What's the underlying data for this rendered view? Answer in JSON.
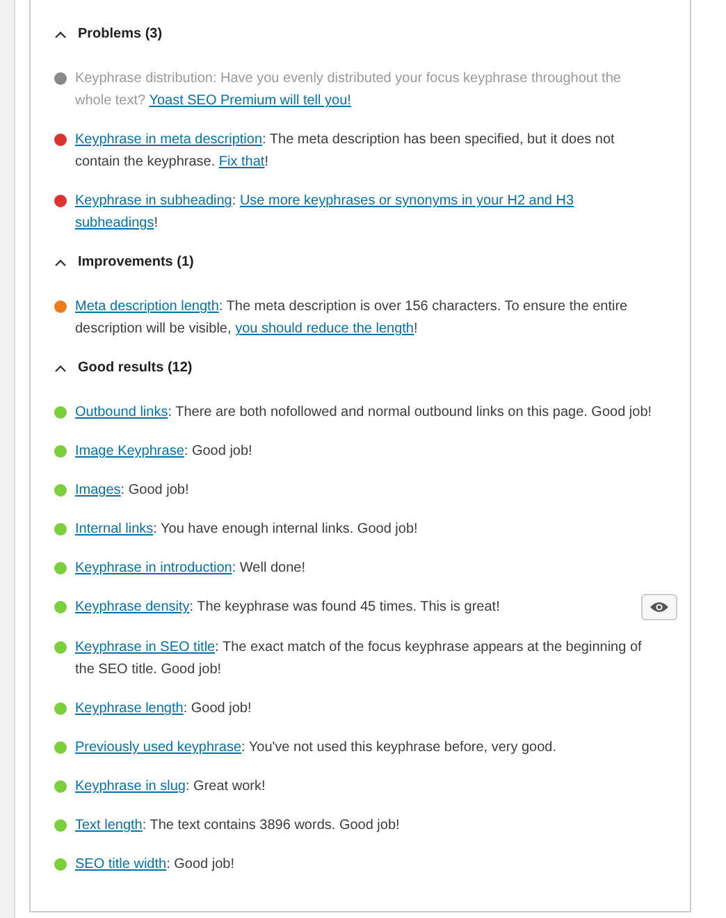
{
  "sections": [
    {
      "title": "Problems (3)",
      "expanded": true,
      "items": [
        {
          "color": "#888888",
          "muted": true,
          "eye_button": false,
          "parts": [
            {
              "text": "Keyphrase distribution: Have you evenly distributed your focus keyphrase throughout the whole text? ",
              "link": false
            },
            {
              "text": "Yoast SEO Premium will tell you!",
              "link": true
            }
          ]
        },
        {
          "color": "#dc3232",
          "muted": false,
          "eye_button": false,
          "parts": [
            {
              "text": "Keyphrase in meta description",
              "link": true
            },
            {
              "text": ": The meta description has been specified, but it does not contain the keyphrase. ",
              "link": false
            },
            {
              "text": "Fix that",
              "link": true
            },
            {
              "text": "!",
              "link": false
            }
          ]
        },
        {
          "color": "#dc3232",
          "muted": false,
          "eye_button": false,
          "parts": [
            {
              "text": "Keyphrase in subheading",
              "link": true
            },
            {
              "text": ": ",
              "link": false
            },
            {
              "text": "Use more keyphrases or synonyms in your H2 and H3",
              "link": true
            },
            {
              "text": "subheadings",
              "link": true
            },
            {
              "text": "!",
              "link": false
            }
          ]
        }
      ]
    },
    {
      "title": "Improvements (1)",
      "expanded": true,
      "items": [
        {
          "color": "#ee7c1b",
          "muted": false,
          "eye_button": false,
          "parts": [
            {
              "text": "Meta description length",
              "link": true
            },
            {
              "text": ": The meta description is over 156 characters. To ensure the entire description will be visible, ",
              "link": false
            },
            {
              "text": "you should reduce the length",
              "link": true
            },
            {
              "text": "!",
              "link": false
            }
          ]
        }
      ]
    },
    {
      "title": "Good results (12)",
      "expanded": true,
      "items": [
        {
          "color": "#7ad03a",
          "muted": false,
          "eye_button": false,
          "parts": [
            {
              "text": "Outbound links",
              "link": true
            },
            {
              "text": ": There are both nofollowed and normal outbound links on this page. Good job!",
              "link": false
            }
          ]
        },
        {
          "color": "#7ad03a",
          "muted": false,
          "eye_button": false,
          "parts": [
            {
              "text": "Image Keyphrase",
              "link": true
            },
            {
              "text": ": Good job!",
              "link": false
            }
          ]
        },
        {
          "color": "#7ad03a",
          "muted": false,
          "eye_button": false,
          "parts": [
            {
              "text": "Images",
              "link": true
            },
            {
              "text": ": Good job!",
              "link": false
            }
          ]
        },
        {
          "color": "#7ad03a",
          "muted": false,
          "eye_button": false,
          "parts": [
            {
              "text": "Internal links",
              "link": true
            },
            {
              "text": ": You have enough internal links. Good job!",
              "link": false
            }
          ]
        },
        {
          "color": "#7ad03a",
          "muted": false,
          "eye_button": false,
          "parts": [
            {
              "text": "Keyphrase in introduction",
              "link": true
            },
            {
              "text": ": Well done!",
              "link": false
            }
          ]
        },
        {
          "color": "#7ad03a",
          "muted": false,
          "eye_button": true,
          "parts": [
            {
              "text": "Keyphrase density",
              "link": true
            },
            {
              "text": ": The keyphrase was found 45 times. This is great!",
              "link": false
            }
          ]
        },
        {
          "color": "#7ad03a",
          "muted": false,
          "eye_button": false,
          "parts": [
            {
              "text": "Keyphrase in SEO title",
              "link": true
            },
            {
              "text": ": The exact match of the focus keyphrase appears at the beginning of the SEO title. Good job!",
              "link": false
            }
          ]
        },
        {
          "color": "#7ad03a",
          "muted": false,
          "eye_button": false,
          "parts": [
            {
              "text": "Keyphrase length",
              "link": true
            },
            {
              "text": ": Good job!",
              "link": false
            }
          ]
        },
        {
          "color": "#7ad03a",
          "muted": false,
          "eye_button": false,
          "parts": [
            {
              "text": "Previously used keyphrase",
              "link": true
            },
            {
              "text": ": You've not used this keyphrase before, very good.",
              "link": false
            }
          ]
        },
        {
          "color": "#7ad03a",
          "muted": false,
          "eye_button": false,
          "parts": [
            {
              "text": "Keyphrase in slug",
              "link": true
            },
            {
              "text": ": Great work!",
              "link": false
            }
          ]
        },
        {
          "color": "#7ad03a",
          "muted": false,
          "eye_button": false,
          "parts": [
            {
              "text": "Text length",
              "link": true
            },
            {
              "text": ": The text contains 3896 words. Good job!",
              "link": false
            }
          ]
        },
        {
          "color": "#7ad03a",
          "muted": false,
          "eye_button": false,
          "parts": [
            {
              "text": "SEO title width",
              "link": true
            },
            {
              "text": ": Good job!",
              "link": false
            }
          ]
        }
      ]
    }
  ]
}
